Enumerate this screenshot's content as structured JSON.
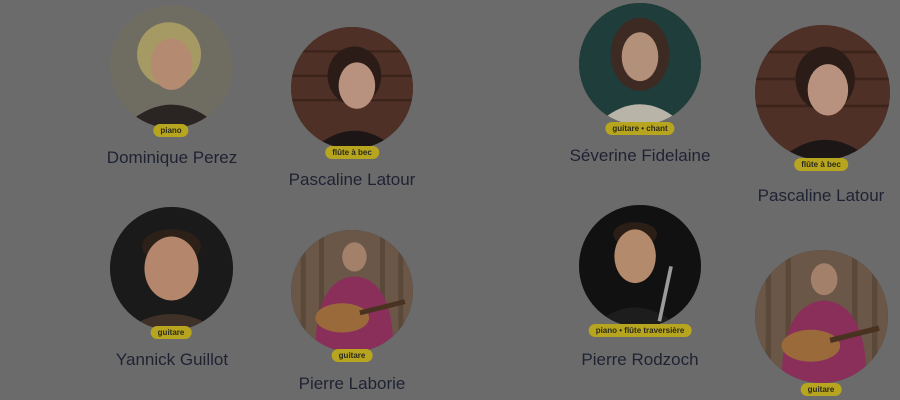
{
  "teachers": [
    {
      "name": "Dominique Perez",
      "instrument": "piano",
      "avatar_icon": "woman-portrait-icon"
    },
    {
      "name": "Pascaline Latour",
      "instrument": "flûte à bec",
      "avatar_icon": "woman-portrait-icon"
    },
    {
      "name": "Séverine Fidelaine",
      "instrument": "guitare • chant",
      "avatar_icon": "woman-portrait-icon"
    },
    {
      "name": "Pascaline Latour",
      "instrument": "flûte à bec",
      "avatar_icon": "woman-portrait-icon"
    },
    {
      "name": "Yannick Guillot",
      "instrument": "guitare",
      "avatar_icon": "man-portrait-icon"
    },
    {
      "name": "Pierre Laborie",
      "instrument": "guitare",
      "avatar_icon": "guitarist-portrait-icon"
    },
    {
      "name": "Pierre Rodzoch",
      "instrument": "piano • flûte traversière",
      "avatar_icon": "flutist-portrait-icon"
    },
    {
      "name": "",
      "instrument": "guitare",
      "avatar_icon": "guitarist-portrait-icon"
    }
  ],
  "colors": {
    "page_background": "#6b6b6b",
    "badge_background": "#b8a51f",
    "name_text": "#1f2233"
  }
}
